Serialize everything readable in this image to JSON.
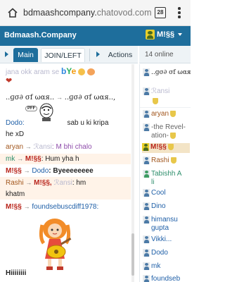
{
  "browser": {
    "url_host": "bdmaashcompany.",
    "url_domain": "chatovod.com",
    "tab_count": "28"
  },
  "header": {
    "site_title": "Bdmaash.Company",
    "user_name": "M!§§"
  },
  "tabs": {
    "main": "Main",
    "join_left": "JOIN/LEFT",
    "actions": "Actions"
  },
  "online": {
    "count_label": "14 online"
  },
  "chat": {
    "messages": [
      {
        "name": "jana okk aram se",
        "text": "",
        "emoji": "bye"
      },
      {
        "name": "",
        "text": "",
        "emoji": "heart"
      },
      {
        "name": "..ɡσ∂ σf ωαя..",
        "arrow": "→",
        "to": "..ɡσ∂ σf ωαя..,",
        "text": ""
      },
      {
        "name": "Dodo:",
        "text": "sab u ki kripa",
        "bubble": "PFF"
      },
      {
        "name": "",
        "text": "he xD"
      },
      {
        "name": "aryan",
        "arrow": "→",
        "to": "ℛansi",
        "text": ": M bhi chalo"
      },
      {
        "name": "mk",
        "arrow": "→",
        "to": "M!§§",
        "text": ": Hum yha h"
      },
      {
        "name": "M!§§",
        "arrow": "→",
        "to": "Dodo",
        "text": ": Byeeeeeeee"
      },
      {
        "name": "Rashi",
        "arrow": "→",
        "to": "M!§§,",
        "to2": "ℛansi",
        "text": ": hm"
      },
      {
        "name": "",
        "text": "khatm"
      },
      {
        "name": "M!§§",
        "arrow": "→",
        "to": "foundsebuscdiff1978:",
        "text": ""
      },
      {
        "name": "",
        "text": "Hiiiiiiii"
      }
    ]
  },
  "users": [
    {
      "name": "..ɡσ∂ σf ωαя..",
      "avatar": "blue",
      "shield": false
    },
    {
      "name": "ℛansi",
      "avatar": "blue",
      "shield": true
    },
    {
      "name": "aryan",
      "avatar": "blue",
      "shield": true
    },
    {
      "name": "-the Revel-",
      "name2": "ation-",
      "avatar": "blue",
      "shield": true
    },
    {
      "name": "M!§§",
      "avatar": "yellow",
      "shield": true
    },
    {
      "name": "Rashi",
      "avatar": "blue",
      "shield": true
    },
    {
      "name": "Tabishh A",
      "name2": "li",
      "avatar": "green",
      "shield": false
    },
    {
      "name": "Cool",
      "avatar": "blue",
      "shield": false
    },
    {
      "name": "Dino",
      "avatar": "blue",
      "shield": false
    },
    {
      "name": "himansu",
      "name2": "gupta",
      "avatar": "blue",
      "shield": false
    },
    {
      "name": "Vikki...",
      "avatar": "blue",
      "shield": false
    },
    {
      "name": "Dodo",
      "avatar": "blue",
      "shield": false
    },
    {
      "name": "mk",
      "avatar": "blue",
      "shield": false
    },
    {
      "name": "foundseb",
      "avatar": "blue",
      "shield": false
    }
  ],
  "colors": {
    "header": "#1e6e9c",
    "tab_active": "#1e6e9c",
    "highlight": "#fff3e8",
    "user_highlight": "#f3e4c6"
  }
}
